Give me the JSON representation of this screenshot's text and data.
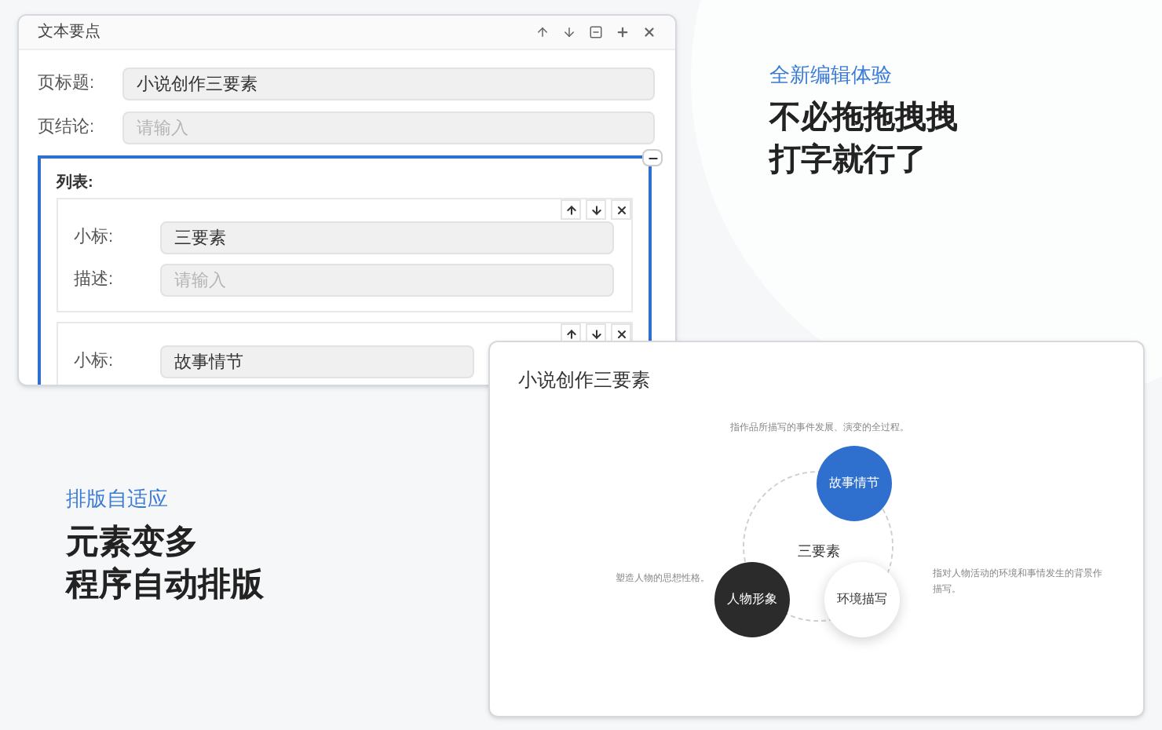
{
  "editor_window": {
    "title": "文本要点",
    "fields": [
      {
        "label": "页标题:",
        "value": "小说创作三要素"
      },
      {
        "label": "页结论:",
        "placeholder": "请输入"
      }
    ],
    "list": {
      "label": "列表:",
      "items": [
        {
          "fields": [
            {
              "label": "小标:",
              "value": "三要素"
            },
            {
              "label": "描述:",
              "placeholder": "请输入"
            }
          ]
        },
        {
          "fields": [
            {
              "label": "小标:",
              "value": "故事情节"
            }
          ]
        }
      ]
    }
  },
  "feature_top": {
    "tagline": "全新编辑体验",
    "headline": [
      "不必拖拖拽拽",
      "打字就行了"
    ]
  },
  "feature_bottom": {
    "tagline": "排版自适应",
    "headline": [
      "元素变多",
      "程序自动排版"
    ]
  },
  "preview_card": {
    "title": "小说创作三要素",
    "center_label": "三要素",
    "nodes": [
      {
        "label": "故事情节",
        "color": "#2f6fce",
        "description": "指作品所描写的事件发展、演变的全过程。"
      },
      {
        "label": "人物形象",
        "color": "#2b2b2b",
        "description": "塑造人物的思想性格。"
      },
      {
        "label": "环境描写",
        "color": "#ffffff",
        "description": "指对人物活动的环境和事情发生的背景作描写。"
      }
    ]
  }
}
